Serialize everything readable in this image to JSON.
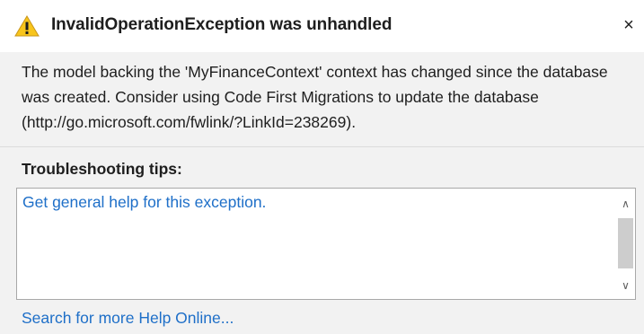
{
  "dialog": {
    "title": "InvalidOperationException was unhandled",
    "close_label": "×",
    "message": "The model backing the 'MyFinanceContext' context has changed since the database was created. Consider using Code First Migrations to update the database (http://go.microsoft.com/fwlink/?LinkId=238269).",
    "troubleshooting": {
      "heading": "Troubleshooting tips:",
      "items": [
        {
          "label": "Get general help for this exception."
        }
      ],
      "scroll_up": "∧",
      "scroll_down": "∨"
    },
    "search_help_link": "Search for more Help Online...",
    "icon": "warning-triangle-icon"
  },
  "colors": {
    "link": "#1e6fc8",
    "warning_icon_fill": "#f8c51c",
    "background": "#f2f2f2",
    "title_background": "#ffffff"
  }
}
